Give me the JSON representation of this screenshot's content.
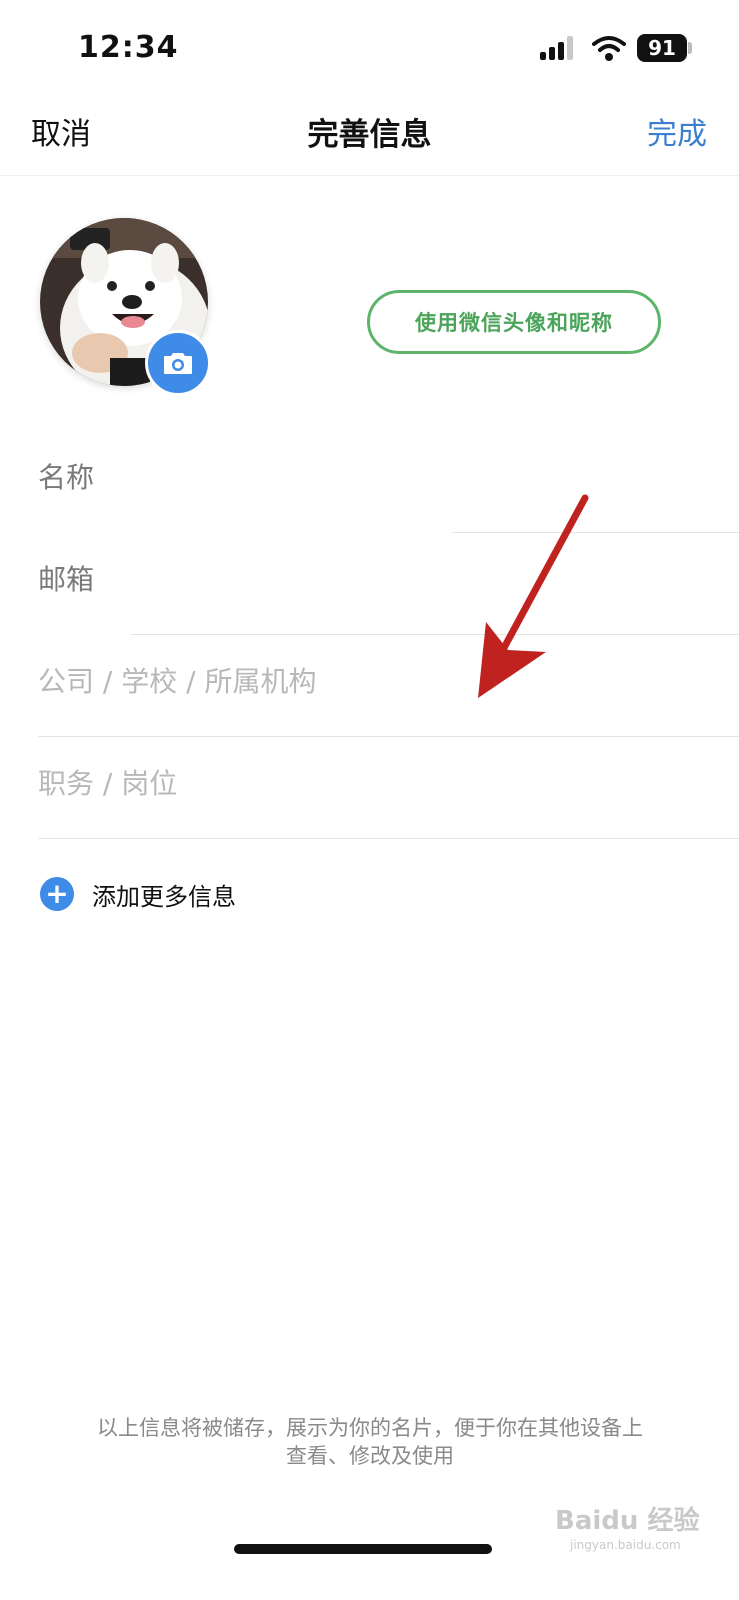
{
  "status_bar": {
    "time": "12:34",
    "battery": "91"
  },
  "navbar": {
    "cancel_label": "取消",
    "title": "完善信息",
    "done_label": "完成"
  },
  "profile": {
    "wechat_button_label": "使用微信头像和昵称"
  },
  "form": {
    "fields": [
      {
        "label": "名称"
      },
      {
        "label": "邮箱"
      },
      {
        "label": "公司 / 学校 / 所属机构"
      },
      {
        "label": "职务 / 岗位"
      }
    ],
    "add_more_label": "添加更多信息"
  },
  "footer": {
    "note_line1": "以上信息将被储存，展示为你的名片，便于你在其他设备上",
    "note_line2": "查看、修改及使用"
  },
  "watermark": {
    "main": "Baidu 经验",
    "sub": "jingyan.baidu.com"
  },
  "colors": {
    "accent_blue": "#3f8be8",
    "link_blue": "#3d7fcf",
    "wechat_green": "#5db46a",
    "arrow_red": "#c0231f"
  }
}
